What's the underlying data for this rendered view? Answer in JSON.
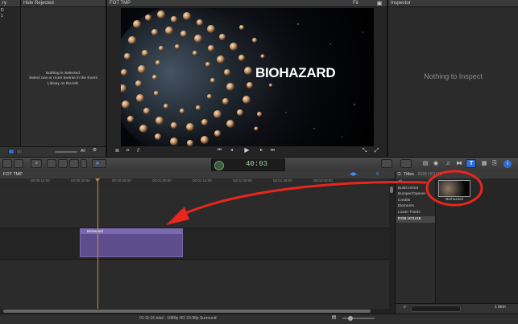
{
  "event_library": {
    "header_left": "ry",
    "header_right": "Hide Rejected",
    "side_items": [
      "D",
      "1"
    ],
    "empty_line1": "Nothing is Selected.",
    "empty_line2": "Select one or more Events in the Event",
    "empty_line3": "Library on the left.",
    "filter_value": "All"
  },
  "viewer": {
    "title": "FOT TMP",
    "fit_label": "Fit",
    "video_text": "BIOHAZARD"
  },
  "inspector": {
    "title": "Inspector",
    "empty": "Nothing to Inspect"
  },
  "toolbar": {
    "timecode": "40:03"
  },
  "timeline": {
    "project_name": "FOT TMP",
    "ruler_ticks": [
      "00:00:15:00",
      "00:00:30:00",
      "00:00:45:00",
      "00:01:00:00",
      "00:01:15:00",
      "00:01:30:00",
      "00:01:45:00",
      "00:02:00:00"
    ],
    "title_clip": "Biohazard",
    "status": "01:11:16 total - 1080p HD 23.98p Surround"
  },
  "titles_browser": {
    "header": "Titles",
    "header_sub": "RGB HOUSE",
    "categories": [
      "All",
      "Build In/Out",
      "Bumper/Opener",
      "Credits",
      "Elements",
      "Lower Thirds",
      "RGB HOUSE"
    ],
    "selected_category": "RGB HOUSE",
    "thumb_label": "Biohazard",
    "count": "1 item"
  },
  "colors": {
    "annotation": "#e8261e",
    "clip": "#5e4d8c",
    "playhead": "#d08c3a",
    "accent": "#2f6dd0"
  }
}
